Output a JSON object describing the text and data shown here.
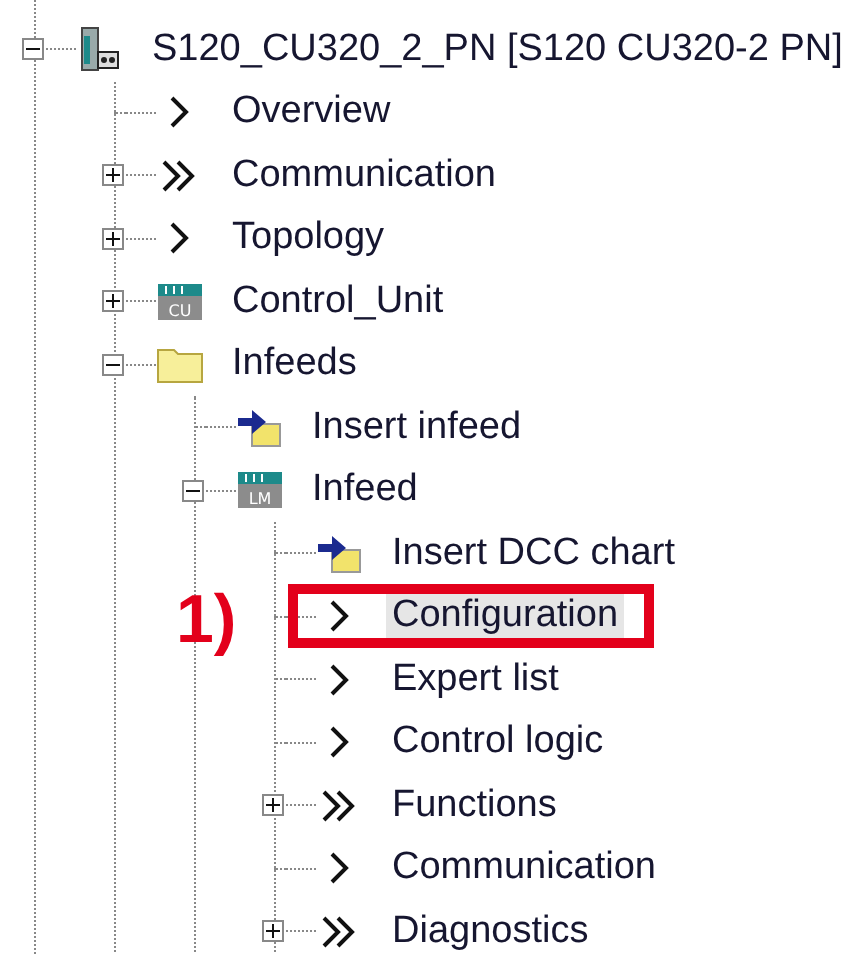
{
  "tree": [
    {
      "label": "S120_CU320_2_PN [S120 CU320-2 PN]",
      "kind": "device",
      "expanded": true,
      "selected": false,
      "children": [
        {
          "label": "Overview",
          "kind": "chevron",
          "selected": false
        },
        {
          "label": "Communication",
          "kind": "double-chevron",
          "expanded": false,
          "selected": false
        },
        {
          "label": "Topology",
          "kind": "chevron",
          "expanded": false,
          "selected": false
        },
        {
          "label": "Control_Unit",
          "kind": "module",
          "badge": "CU",
          "expanded": false,
          "selected": false
        },
        {
          "label": "Infeeds",
          "kind": "folder",
          "expanded": true,
          "selected": false,
          "children": [
            {
              "label": "Insert infeed",
              "kind": "insert",
              "selected": false
            },
            {
              "label": "Infeed",
              "kind": "module",
              "badge": "LM",
              "expanded": true,
              "selected": false,
              "children": [
                {
                  "label": "Insert DCC chart",
                  "kind": "insert",
                  "selected": false
                },
                {
                  "label": "Configuration",
                  "kind": "chevron",
                  "selected": true,
                  "callout": "1)"
                },
                {
                  "label": "Expert list",
                  "kind": "chevron",
                  "selected": false
                },
                {
                  "label": "Control logic",
                  "kind": "chevron",
                  "selected": false
                },
                {
                  "label": "Functions",
                  "kind": "double-chevron",
                  "expanded": false,
                  "selected": false
                },
                {
                  "label": "Communication",
                  "kind": "chevron",
                  "selected": false
                },
                {
                  "label": "Diagnostics",
                  "kind": "double-chevron",
                  "expanded": false,
                  "selected": false
                }
              ]
            }
          ]
        }
      ]
    }
  ]
}
